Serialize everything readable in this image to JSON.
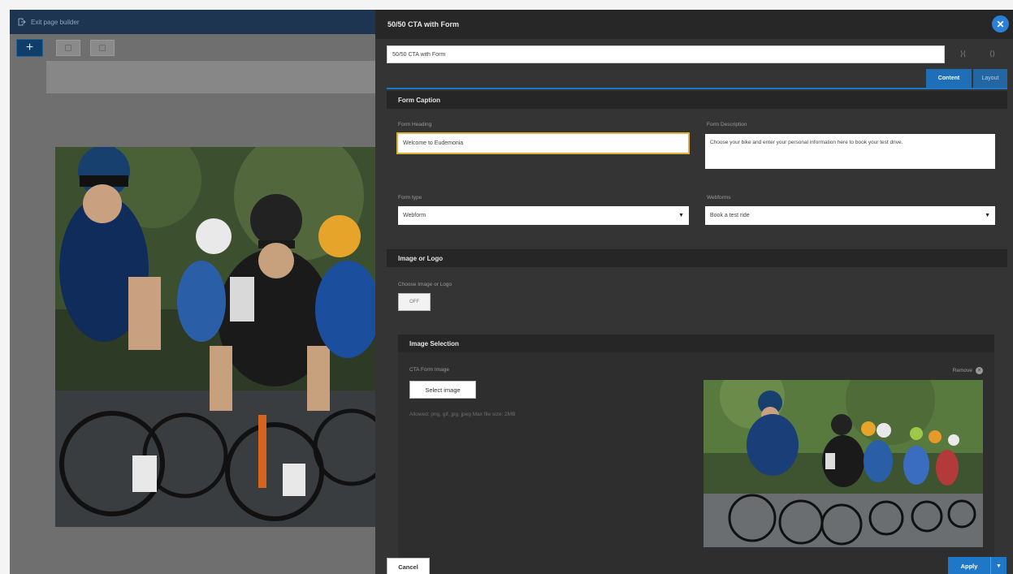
{
  "builder": {
    "exit_label": "Exit page builder",
    "add_label": "+"
  },
  "panel": {
    "title": "50/50 CTA with Form",
    "title_input_value": "50/50 CTA with Form",
    "close_label": "✕",
    "tabs": [
      {
        "label": "Content",
        "active": true
      },
      {
        "label": "Layout",
        "active": false
      }
    ],
    "form_caption": {
      "section_title": "Form Caption",
      "heading_label": "Form Heading",
      "heading_value": "Welcome to Eudemonia",
      "description_label": "Form Description",
      "description_value": "Choose your bike and enter your personal information here to book your test drive.",
      "type_label": "Form type",
      "type_value": "Webform",
      "webforms_label": "Webforms",
      "webforms_value": "Book a test ride"
    },
    "image_logo": {
      "section_title": "Image or Logo",
      "choose_label": "Choose Image or Logo",
      "toggle_value": "OFF"
    },
    "image_selection": {
      "section_title": "Image Selection",
      "field_label": "CTA Form Image",
      "select_button": "Select image",
      "allowed_text": "Allowed: png, gif, jpg, jpeg Max file size: 2MB",
      "remove_label": "Remove"
    },
    "footer": {
      "cancel_label": "Cancel",
      "apply_label": "Apply"
    }
  },
  "colors": {
    "accent": "#1f77c7",
    "panel_bg": "#343434",
    "focus_border": "#e0b23a"
  }
}
